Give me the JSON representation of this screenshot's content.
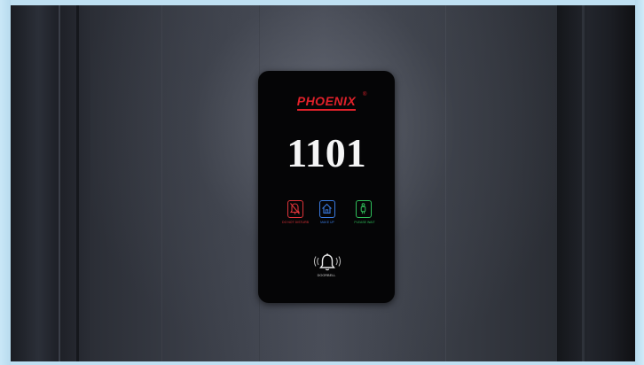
{
  "panel": {
    "brand": "PHOENIX",
    "reg_mark": "®",
    "room_number": "1101",
    "buttons": [
      {
        "label": "DO NOT DISTURB",
        "icon": "do-not-disturb-icon",
        "color": "#e0343a"
      },
      {
        "label": "MAKE UP",
        "icon": "house-icon",
        "color": "#3a7be0"
      },
      {
        "label": "PLEASE WAIT",
        "icon": "person-waiting-icon",
        "color": "#2fbf5a"
      }
    ],
    "doorbell": {
      "label": "DOORBELL",
      "icon": "bell-icon"
    }
  },
  "colors": {
    "brand": "#e0212a",
    "panel_bg": "#050506",
    "number": "#f5f5f5"
  }
}
